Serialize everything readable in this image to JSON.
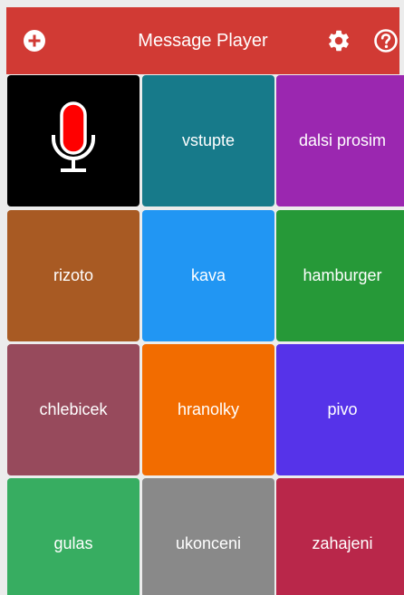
{
  "appbar": {
    "title": "Message Player",
    "background": "#d13a34",
    "icons": [
      "plus-circle-icon",
      "gear-icon",
      "help-circle-icon"
    ]
  },
  "record_tile": {
    "icon": "microphone-icon",
    "background": "#000000",
    "mic_color": "#ff0000"
  },
  "tiles": [
    {
      "label": "vstupte",
      "color": "#177a8a"
    },
    {
      "label": "dalsi prosim",
      "color": "#9b27b0"
    },
    {
      "label": "rizoto",
      "color": "#a85a23"
    },
    {
      "label": "kava",
      "color": "#2196f3"
    },
    {
      "label": "hamburger",
      "color": "#269938"
    },
    {
      "label": "chlebicek",
      "color": "#974a5c"
    },
    {
      "label": "hranolky",
      "color": "#f26c00"
    },
    {
      "label": "pivo",
      "color": "#5633e9"
    },
    {
      "label": "gulas",
      "color": "#37ad61"
    },
    {
      "label": "ukonceni",
      "color": "#898989"
    },
    {
      "label": "zahajeni",
      "color": "#b9274a"
    }
  ]
}
